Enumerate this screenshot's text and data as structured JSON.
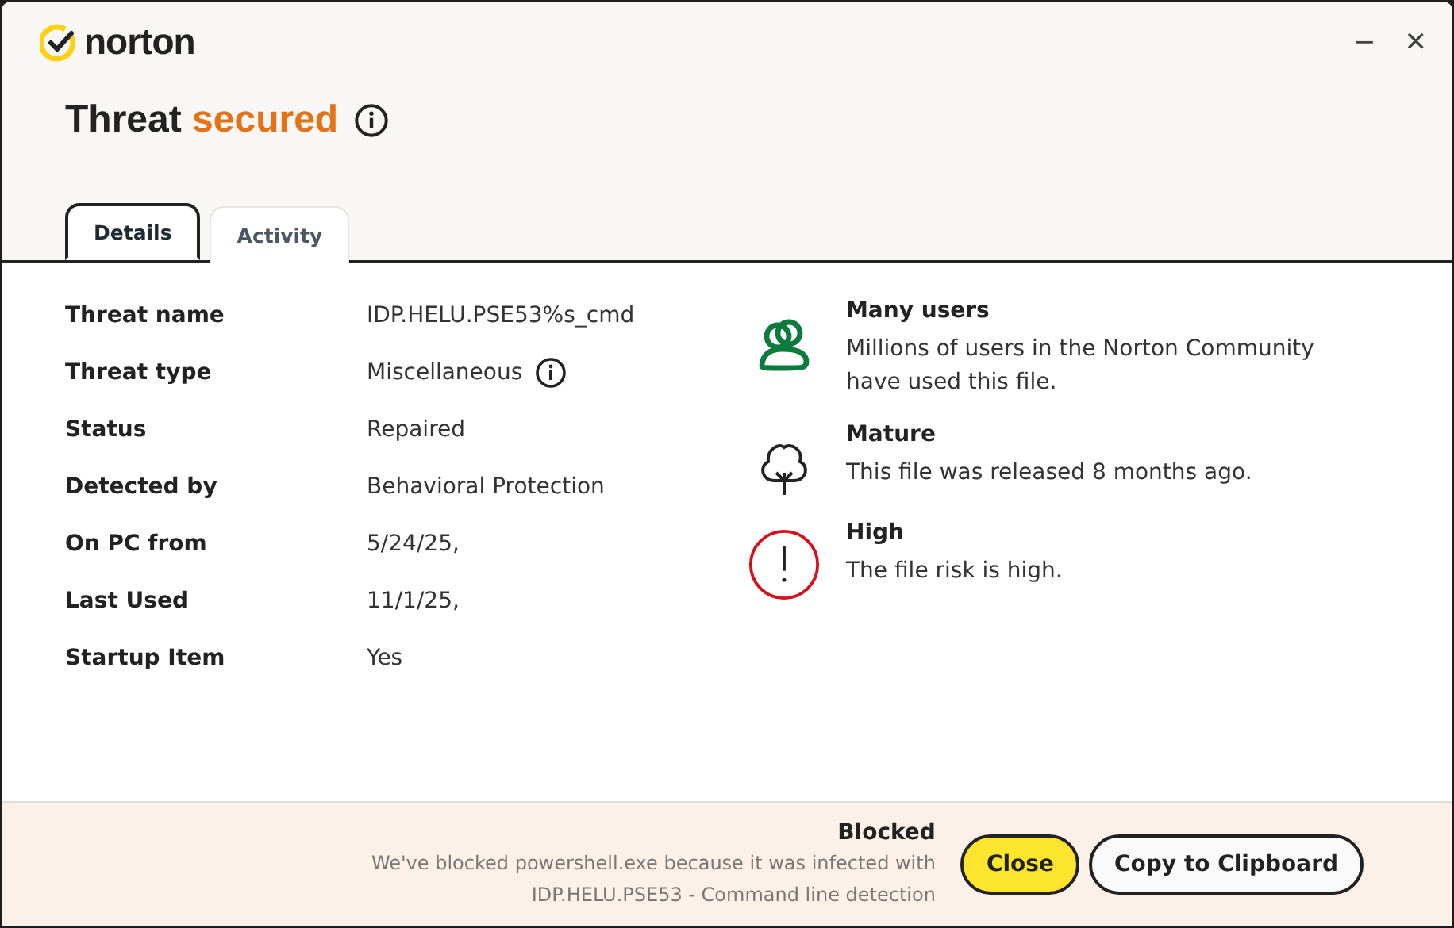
{
  "window": {
    "brand": "norton",
    "minimize": "−",
    "close": "✕"
  },
  "title": {
    "lead": "Threat",
    "accent": "secured",
    "info": true
  },
  "tabs": [
    {
      "label": "Details",
      "selected": true
    },
    {
      "label": "Activity",
      "selected": false
    }
  ],
  "details": [
    {
      "label": "Threat name",
      "value": "IDP.HELU.PSE53%s_cmd",
      "info": false
    },
    {
      "label": "Threat type",
      "value": "Miscellaneous",
      "info": true
    },
    {
      "label": "Status",
      "value": "Repaired",
      "info": false
    },
    {
      "label": "Detected by",
      "value": "Behavioral Protection",
      "info": false
    },
    {
      "label": "On PC from",
      "value": "5/24/25,",
      "info": false
    },
    {
      "label": "Last Used",
      "value": "11/1/25,",
      "info": false
    },
    {
      "label": "Startup Item",
      "value": "Yes",
      "info": false
    }
  ],
  "facts": [
    {
      "kind": "users",
      "heading": "Many users",
      "text": "Millions of users in the Norton Community have used this file."
    },
    {
      "kind": "age",
      "heading": "Mature",
      "text": "This file was released 8 months ago."
    },
    {
      "kind": "risk",
      "heading": "High",
      "text": "The file risk is high."
    }
  ],
  "footer": {
    "heading": "Blocked",
    "lines": [
      "We've blocked powershell.exe because it was infected with",
      "IDP.HELU.PSE53 - Command line detection"
    ],
    "buttons": [
      {
        "label": "Close",
        "kind": "primary"
      },
      {
        "label": "Copy to Clipboard",
        "kind": "secondary"
      }
    ]
  }
}
